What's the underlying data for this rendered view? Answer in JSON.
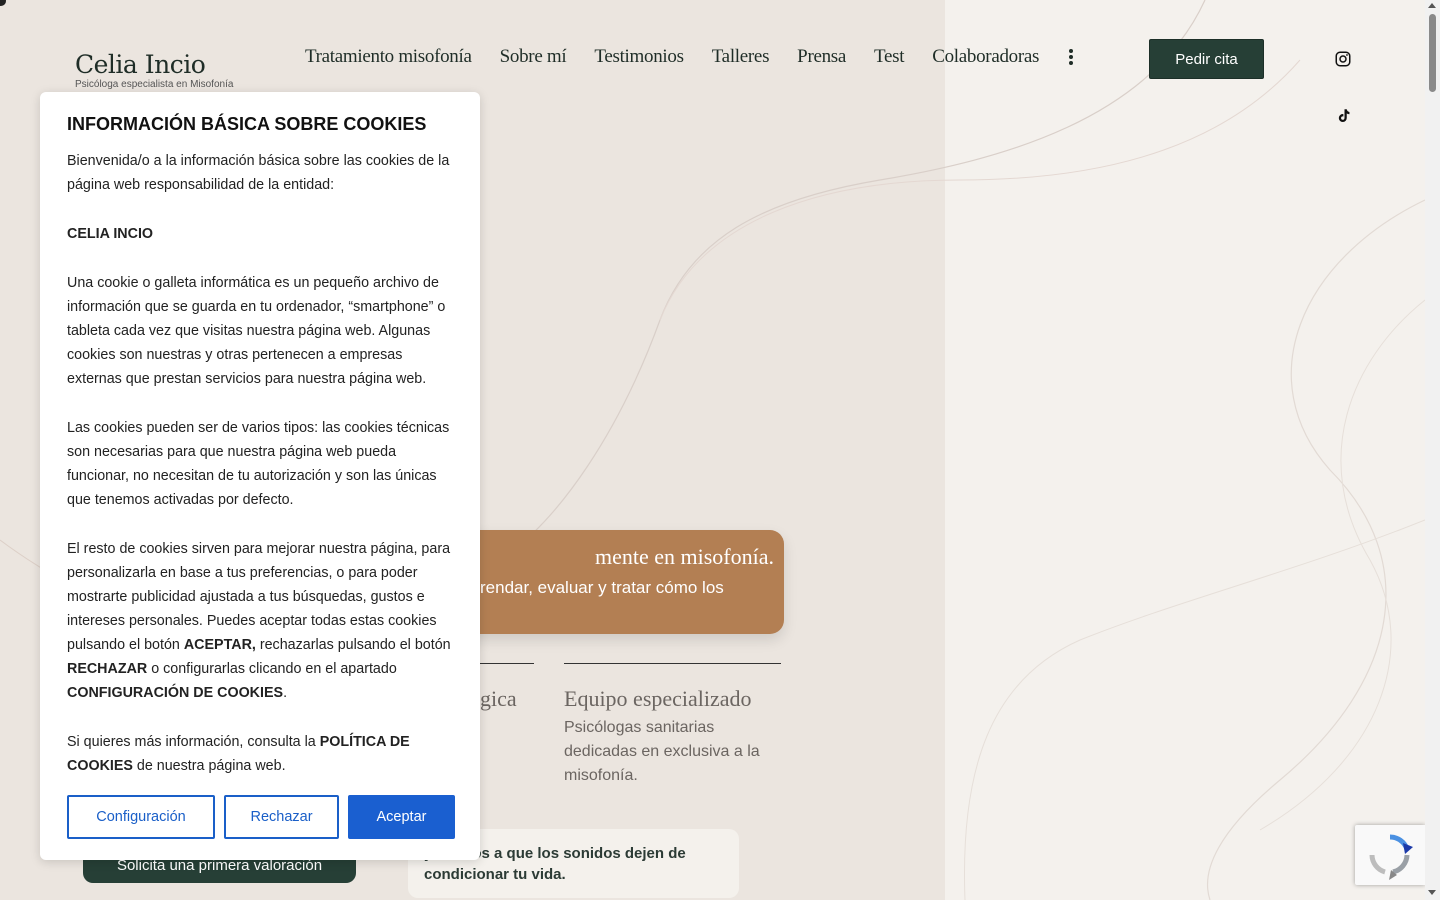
{
  "header": {
    "logo_name": "Celia Incio",
    "logo_subtitle": "Psicóloga especialista en Misofonía",
    "nav": [
      "Tratamiento misofonía",
      "Sobre mí",
      "Testimonios",
      "Talleres",
      "Prensa",
      "Test",
      "Colaboradoras"
    ],
    "cta_label": "Pedir cita"
  },
  "hero": {
    "card_title": "mente en misofonía.",
    "card_text": "rendar, evaluar y tratar cómo los",
    "feature_a_title": "gica",
    "feature_b_title": "Equipo especializado",
    "feature_b_text": "Psicólogas sanitarias dedicadas en exclusiva a la misofonía.",
    "primary_button": "Solicita una primera valoración",
    "note": "yudamos a que los sonidos dejen de condicionar tu vida."
  },
  "cookie": {
    "title": "INFORMACIÓN BÁSICA SOBRE COOKIES",
    "p1": "Bienvenida/o a la información básica sobre las cookies de la página web responsabilidad de la entidad:",
    "p2": "CELIA INCIO",
    "p3": "Una cookie o galleta informática es un pequeño archivo de información que se guarda en tu ordenador, “smartphone” o tableta cada vez que visitas nuestra página web. Algunas cookies son nuestras y otras pertenecen a empresas externas que prestan servicios para nuestra página web.",
    "p4": "Las cookies pueden ser de varios tipos: las cookies técnicas son necesarias para que nuestra página web pueda funcionar, no necesitan de tu autorización y son las únicas que tenemos activadas por defecto.",
    "p5_a": "El resto de cookies sirven para mejorar nuestra página, para personalizarla en base a tus preferencias, o para poder mostrarte publicidad ajustada a tus búsquedas, gustos e intereses personales. Puedes aceptar todas estas cookies pulsando el botón ",
    "p5_b": "ACEPTAR,",
    "p5_c": " rechazarlas pulsando el botón ",
    "p5_d": "RECHAZAR",
    "p5_e": " o configurarlas clicando en el apartado ",
    "p5_f": "CONFIGURACIÓN DE COOKIES",
    "p5_g": ".",
    "p6_a": "Si quieres más información, consulta la ",
    "p6_b": "POLÍTICA DE COOKIES",
    "p6_c": " de nuestra página web.",
    "btn_config": "Configuración",
    "btn_reject": "Rechazar",
    "btn_accept": "Aceptar"
  },
  "icons": {
    "instagram": "instagram-icon",
    "tiktok": "tiktok-icon",
    "more": "more-vertical-icon",
    "recaptcha": "recaptcha-icon"
  },
  "colors": {
    "brand_green": "#263f36",
    "accent_brown": "#b37f53",
    "cookie_blue": "#1a5fc8"
  }
}
